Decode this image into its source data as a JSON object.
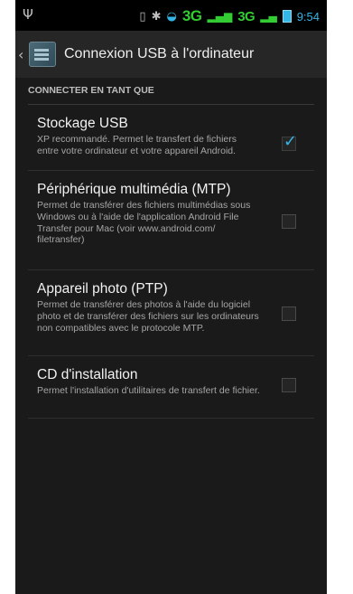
{
  "status_bar": {
    "network": "3G",
    "time": "9:54"
  },
  "action_bar": {
    "title": "Connexion USB à l'ordinateur"
  },
  "section": {
    "header": "CONNECTER EN TANT QUE"
  },
  "options": [
    {
      "title": "Stockage USB",
      "summary": "XP recommandé. Permet le transfert de fichiers entre votre ordinateur et votre appareil Android.",
      "checked": true
    },
    {
      "title": "Périphérique multimédia (MTP)",
      "summary": "Permet de transférer des fichiers multimédias sous Windows ou à l'aide de l'application Android File Transfer pour Mac (voir www.android.com/ filetransfer)",
      "checked": false
    },
    {
      "title": "Appareil photo (PTP)",
      "summary": "Permet de transférer des photos à l'aide du logiciel photo et de transférer des fichiers sur les ordinateurs non compatibles avec le protocole MTP.",
      "checked": false
    },
    {
      "title": "CD d'installation",
      "summary": "Permet l'installation d'utilitaires de transfert de fichier.",
      "checked": false
    }
  ],
  "colors": {
    "accent": "#33b5e5",
    "network": "#33cc33"
  }
}
